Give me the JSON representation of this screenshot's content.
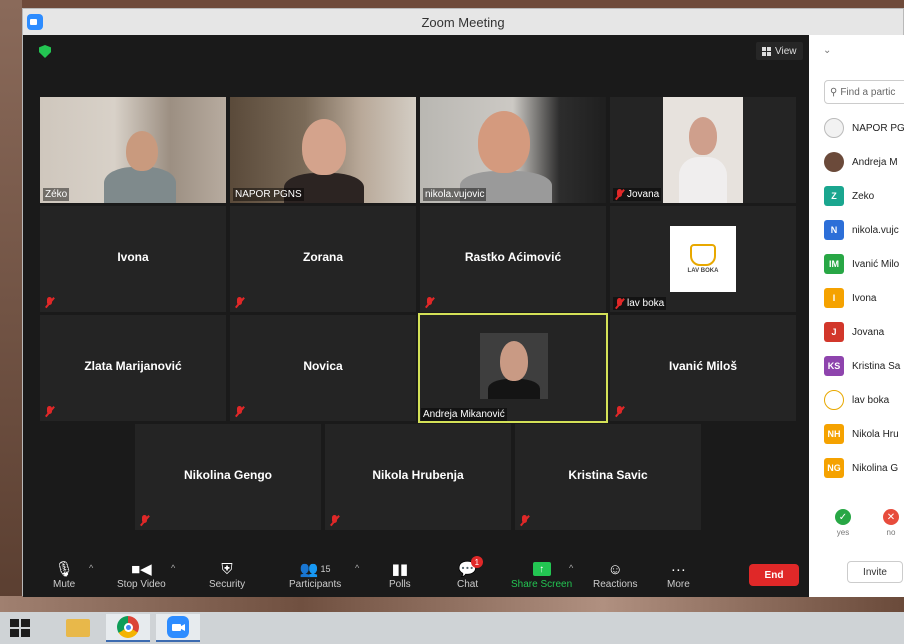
{
  "window": {
    "title": "Zoom Meeting"
  },
  "topbar": {
    "view_label": "View"
  },
  "tiles": [
    {
      "name": "Zéko",
      "label": "Zéko",
      "type": "video",
      "muted": false
    },
    {
      "name": "NAPOR PGNS",
      "label": "NAPOR PGNS",
      "type": "video",
      "muted": false
    },
    {
      "name": "nikola.vujovic",
      "label": "nikola.vujovic",
      "type": "video",
      "muted": false
    },
    {
      "name": "Jovana",
      "label": "Jovana",
      "type": "video",
      "muted": true
    },
    {
      "name": "Ivona",
      "type": "name",
      "muted": true
    },
    {
      "name": "Zorana",
      "type": "name",
      "muted": true
    },
    {
      "name": "Rastko Aćimović",
      "type": "name",
      "muted": true
    },
    {
      "name": "lav boka",
      "label": "lav boka",
      "type": "logo",
      "logo_text": "LAV BOKA",
      "muted": true
    },
    {
      "name": "Zlata Marijanović",
      "type": "name",
      "muted": true
    },
    {
      "name": "Novica",
      "type": "name",
      "muted": true
    },
    {
      "name": "Andreja Mikanović",
      "label": "Andreja Mikanović",
      "type": "video",
      "muted": false,
      "speaking": true
    },
    {
      "name": "Ivanić Miloš",
      "type": "name",
      "muted": true
    },
    {
      "name": "Nikolina Gengo",
      "type": "name",
      "muted": true
    },
    {
      "name": "Nikola Hrubenja",
      "type": "name",
      "muted": true
    },
    {
      "name": "Kristina Savic",
      "type": "name",
      "muted": true
    }
  ],
  "toolbar": {
    "mute": "Mute",
    "stop_video": "Stop Video",
    "security": "Security",
    "participants": "Participants",
    "participants_count": "15",
    "polls": "Polls",
    "chat": "Chat",
    "chat_badge": "1",
    "share_screen": "Share Screen",
    "reactions": "Reactions",
    "more": "More",
    "end": "End"
  },
  "panel": {
    "search_placeholder": "Find a partic",
    "participants": [
      {
        "name": "NAPOR PG",
        "avatar": "",
        "color": "#ffffff",
        "image": true
      },
      {
        "name": "Andreja M",
        "avatar": "",
        "color": "#6b4a3a",
        "image": true
      },
      {
        "name": "Zeko",
        "avatar": "Z",
        "color": "#1aa68f"
      },
      {
        "name": "nikola.vujc",
        "avatar": "N",
        "color": "#2d6fd8"
      },
      {
        "name": "Ivanić Milo",
        "avatar": "IM",
        "color": "#28a745"
      },
      {
        "name": "Ivona",
        "avatar": "I",
        "color": "#f5a200"
      },
      {
        "name": "Jovana",
        "avatar": "J",
        "color": "#d2372b"
      },
      {
        "name": "Kristina Sa",
        "avatar": "KS",
        "color": "#8e44ad"
      },
      {
        "name": "lav boka",
        "avatar": "",
        "color": "#ffffff",
        "image": true
      },
      {
        "name": "Nikola Hru",
        "avatar": "NH",
        "color": "#f5a200"
      },
      {
        "name": "Nikolina G",
        "avatar": "NG",
        "color": "#f5a200"
      }
    ],
    "reactions": [
      {
        "label": "yes",
        "symbol": "✓",
        "color": "#28a745"
      },
      {
        "label": "no",
        "symbol": "✕",
        "color": "#e74c3c"
      }
    ],
    "invite": "Invite"
  }
}
